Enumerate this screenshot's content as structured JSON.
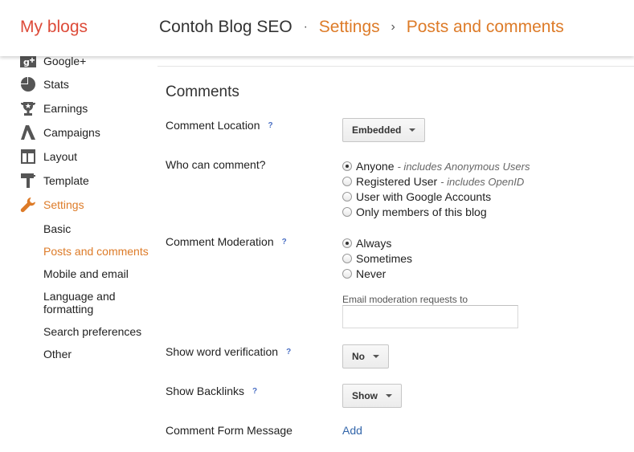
{
  "header": {
    "brand": "My blogs",
    "blog_name": "Contoh Blog SEO",
    "separator_1": "·",
    "crumb_settings": "Settings",
    "separator_2": "›",
    "crumb_page": "Posts and comments"
  },
  "sidebar": {
    "items": [
      {
        "label": "Google+",
        "icon": "google-plus-icon"
      },
      {
        "label": "Stats",
        "icon": "stats-pie-icon"
      },
      {
        "label": "Earnings",
        "icon": "trophy-icon"
      },
      {
        "label": "Campaigns",
        "icon": "campaigns-icon"
      },
      {
        "label": "Layout",
        "icon": "layout-icon"
      },
      {
        "label": "Template",
        "icon": "paint-roller-icon"
      },
      {
        "label": "Settings",
        "icon": "wrench-icon"
      }
    ],
    "sub_items": [
      "Basic",
      "Posts and comments",
      "Mobile and email",
      "Language and formatting",
      "Search preferences",
      "Other"
    ]
  },
  "comments": {
    "section_title": "Comments",
    "help_glyph": "?",
    "location": {
      "label": "Comment Location",
      "value": "Embedded"
    },
    "who": {
      "label": "Who can comment?",
      "options": [
        {
          "label": "Anyone",
          "note": "- includes Anonymous Users",
          "checked": true
        },
        {
          "label": "Registered User",
          "note": "- includes OpenID",
          "checked": false
        },
        {
          "label": "User with Google Accounts",
          "note": "",
          "checked": false
        },
        {
          "label": "Only members of this blog",
          "note": "",
          "checked": false
        }
      ]
    },
    "moderation": {
      "label": "Comment Moderation",
      "options": [
        {
          "label": "Always",
          "checked": true
        },
        {
          "label": "Sometimes",
          "checked": false
        },
        {
          "label": "Never",
          "checked": false
        }
      ],
      "email_label": "Email moderation requests to",
      "email_value": ""
    },
    "word_verification": {
      "label": "Show word verification",
      "value": "No"
    },
    "backlinks": {
      "label": "Show Backlinks",
      "value": "Show"
    },
    "form_message": {
      "label": "Comment Form Message",
      "action": "Add"
    }
  },
  "colors": {
    "accent": "#dd7b28",
    "brand": "#dd4b39",
    "link": "#3366aa"
  }
}
